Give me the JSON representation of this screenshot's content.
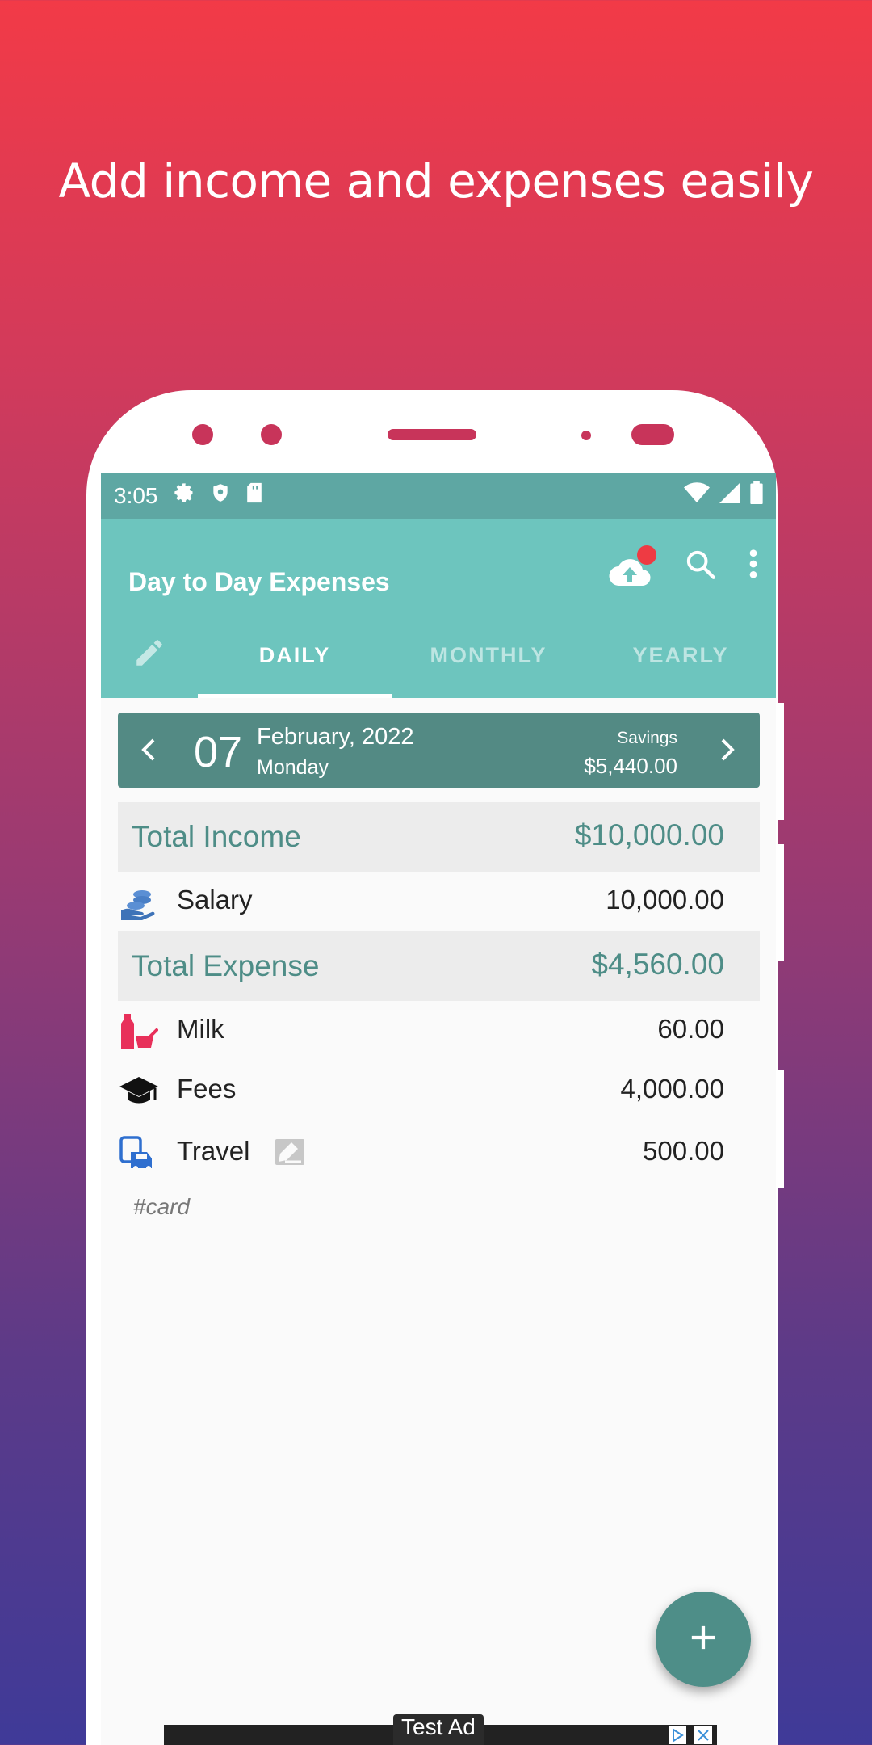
{
  "headline": "Add income and expenses easily",
  "status": {
    "time": "3:05"
  },
  "app": {
    "title": "Day to Day Expenses"
  },
  "tabs": [
    "DAILY",
    "MONTHLY",
    "YEARLY"
  ],
  "date": {
    "day": "07",
    "month_year": "February, 2022",
    "weekday": "Monday",
    "savings_label": "Savings",
    "savings_value": "$5,440.00"
  },
  "income": {
    "label": "Total Income",
    "total": "$10,000.00",
    "items": [
      {
        "name": "Salary",
        "amount": "10,000.00",
        "icon": "salary-icon"
      }
    ]
  },
  "expense": {
    "label": "Total Expense",
    "total": "$4,560.00",
    "items": [
      {
        "name": "Milk",
        "amount": "60.00",
        "icon": "milk-icon"
      },
      {
        "name": "Fees",
        "amount": "4,000.00",
        "icon": "graduation-cap-icon"
      },
      {
        "name": "Travel",
        "amount": "500.00",
        "icon": "transport-icon"
      }
    ]
  },
  "note": "#card",
  "ad": {
    "label": "Test Ad"
  },
  "colors": {
    "primary": "#6dc5be",
    "primary_dark": "#5ea7a3",
    "date_bar": "#538a84",
    "accent_text": "#4e8d87"
  }
}
